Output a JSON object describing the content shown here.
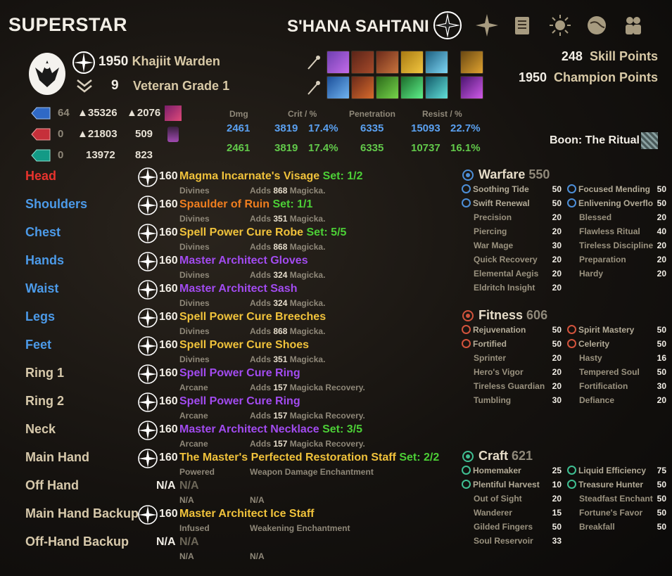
{
  "header": {
    "title": "SUPERSTAR",
    "character_name": "S'HANA SAHTANI",
    "nav_icons": [
      "champion-icon",
      "skills-icon",
      "scroll-icon",
      "sun-icon",
      "globe-icon",
      "group-icon"
    ]
  },
  "profile": {
    "cp_level": "1950",
    "race_class": "Khajiit Warden",
    "rank": "9",
    "grade": "Veteran Grade 1"
  },
  "points": {
    "skill_value": "248",
    "skill_label": "Skill Points",
    "champion_value": "1950",
    "champion_label": "Champion Points"
  },
  "resources": [
    {
      "color": "#2f69c6",
      "a": "64",
      "b": "▲35326",
      "c": "▲2076"
    },
    {
      "color": "#c6303a",
      "a": "0",
      "b": "▲21803",
      "c": "509"
    },
    {
      "color": "#139a86",
      "a": "0",
      "b": "13972",
      "c": "823"
    }
  ],
  "stats": {
    "headers": {
      "dmg": "Dmg",
      "crit": "Crit / %",
      "pen": "Penetration",
      "resist": "Resist / %"
    },
    "row1": {
      "dmg": "2461",
      "crit": "3819",
      "crit_pct": "17.4%",
      "pen": "6335",
      "resist": "15093",
      "resist_pct": "22.7%"
    },
    "row2": {
      "dmg": "2461",
      "crit": "3819",
      "crit_pct": "17.4%",
      "pen": "6335",
      "resist": "10737",
      "resist_pct": "16.1%"
    }
  },
  "boon": "Boon: The Ritual",
  "equipment": [
    {
      "slot": "Head",
      "cp": "160",
      "item": "Magma Incarnate's Visage",
      "set": "Set: 1/2",
      "trait": "Divines",
      "enchant_pre": "Adds",
      "enchant_val": "868",
      "enchant_post": "Magicka."
    },
    {
      "slot": "Shoulders",
      "cp": "160",
      "item": "Spaulder of Ruin",
      "set": "Set: 1/1",
      "trait": "Divines",
      "enchant_pre": "Adds",
      "enchant_val": "351",
      "enchant_post": "Magicka."
    },
    {
      "slot": "Chest",
      "cp": "160",
      "item": "Spell Power Cure Robe",
      "set": "Set: 5/5",
      "trait": "Divines",
      "enchant_pre": "Adds",
      "enchant_val": "868",
      "enchant_post": "Magicka."
    },
    {
      "slot": "Hands",
      "cp": "160",
      "item": "Master Architect Gloves",
      "set": "",
      "trait": "Divines",
      "enchant_pre": "Adds",
      "enchant_val": "324",
      "enchant_post": "Magicka."
    },
    {
      "slot": "Waist",
      "cp": "160",
      "item": "Master Architect Sash",
      "set": "",
      "trait": "Divines",
      "enchant_pre": "Adds",
      "enchant_val": "324",
      "enchant_post": "Magicka."
    },
    {
      "slot": "Legs",
      "cp": "160",
      "item": "Spell Power Cure Breeches",
      "set": "",
      "trait": "Divines",
      "enchant_pre": "Adds",
      "enchant_val": "868",
      "enchant_post": "Magicka."
    },
    {
      "slot": "Feet",
      "cp": "160",
      "item": "Spell Power Cure Shoes",
      "set": "",
      "trait": "Divines",
      "enchant_pre": "Adds",
      "enchant_val": "351",
      "enchant_post": "Magicka."
    },
    {
      "slot": "Ring 1",
      "cp": "160",
      "item": "Spell Power Cure Ring",
      "set": "",
      "trait": "Arcane",
      "enchant_pre": "Adds",
      "enchant_val": "157",
      "enchant_post": "Magicka Recovery."
    },
    {
      "slot": "Ring 2",
      "cp": "160",
      "item": "Spell Power Cure Ring",
      "set": "",
      "trait": "Arcane",
      "enchant_pre": "Adds",
      "enchant_val": "157",
      "enchant_post": "Magicka Recovery."
    },
    {
      "slot": "Neck",
      "cp": "160",
      "item": "Master Architect Necklace",
      "set": "Set: 3/5",
      "trait": "Arcane",
      "enchant_pre": "Adds",
      "enchant_val": "157",
      "enchant_post": "Magicka Recovery."
    },
    {
      "slot": "Main Hand",
      "cp": "160",
      "item": "The Master's Perfected Restoration Staff",
      "set": "Set: 2/2",
      "trait": "Powered",
      "enchant_pre": "Weapon Damage Enchantment",
      "enchant_val": "",
      "enchant_post": ""
    },
    {
      "slot": "Off Hand",
      "cp": "N/A",
      "item": "N/A",
      "set": "",
      "trait": "N/A",
      "enchant_pre": "N/A",
      "enchant_val": "",
      "enchant_post": ""
    },
    {
      "slot": "Main Hand Backup",
      "cp": "160",
      "item": "Master Architect Ice Staff",
      "set": "",
      "trait": "Infused",
      "enchant_pre": "Weakening Enchantment",
      "enchant_val": "",
      "enchant_post": ""
    },
    {
      "slot": "Off-Hand Backup",
      "cp": "N/A",
      "item": "N/A",
      "set": "",
      "trait": "N/A",
      "enchant_pre": "N/A",
      "enchant_val": "",
      "enchant_post": ""
    }
  ],
  "champion": {
    "warfare": {
      "name": "Warfare",
      "total": "550",
      "left": [
        {
          "name": "Soothing Tide",
          "v": "50"
        },
        {
          "name": "Swift Renewal",
          "v": "50"
        },
        {
          "name": "Precision",
          "v": "20"
        },
        {
          "name": "Piercing",
          "v": "20"
        },
        {
          "name": "War Mage",
          "v": "30"
        },
        {
          "name": "Quick Recovery",
          "v": "20"
        },
        {
          "name": "Elemental Aegis",
          "v": "20"
        },
        {
          "name": "Eldritch Insight",
          "v": "20"
        }
      ],
      "right": [
        {
          "name": "Focused Mending",
          "v": "50"
        },
        {
          "name": "Enlivening Overflo",
          "v": "50"
        },
        {
          "name": "Blessed",
          "v": "20"
        },
        {
          "name": "Flawless Ritual",
          "v": "40"
        },
        {
          "name": "Tireless Discipline",
          "v": "20"
        },
        {
          "name": "Preparation",
          "v": "20"
        },
        {
          "name": "Hardy",
          "v": "20"
        }
      ]
    },
    "fitness": {
      "name": "Fitness",
      "total": "606",
      "left": [
        {
          "name": "Rejuvenation",
          "v": "50"
        },
        {
          "name": "Fortified",
          "v": "50"
        },
        {
          "name": "Sprinter",
          "v": "20"
        },
        {
          "name": "Hero's Vigor",
          "v": "20"
        },
        {
          "name": "Tireless Guardian",
          "v": "20"
        },
        {
          "name": "Tumbling",
          "v": "30"
        }
      ],
      "right": [
        {
          "name": "Spirit Mastery",
          "v": "50"
        },
        {
          "name": "Celerity",
          "v": "50"
        },
        {
          "name": "Hasty",
          "v": "16"
        },
        {
          "name": "Tempered Soul",
          "v": "50"
        },
        {
          "name": "Fortification",
          "v": "30"
        },
        {
          "name": "Defiance",
          "v": "20"
        }
      ]
    },
    "craft": {
      "name": "Craft",
      "total": "621",
      "left": [
        {
          "name": "Homemaker",
          "v": "25"
        },
        {
          "name": "Plentiful Harvest",
          "v": "10"
        },
        {
          "name": "Out of Sight",
          "v": "20"
        },
        {
          "name": "Wanderer",
          "v": "15"
        },
        {
          "name": "Gilded Fingers",
          "v": "50"
        },
        {
          "name": "Soul Reservoir",
          "v": "33"
        }
      ],
      "right": [
        {
          "name": "Liquid Efficiency",
          "v": "75"
        },
        {
          "name": "Treasure Hunter",
          "v": "50"
        },
        {
          "name": "Steadfast Enchant",
          "v": "50"
        },
        {
          "name": "Fortune's Favor",
          "v": "50"
        },
        {
          "name": "Breakfall",
          "v": "50"
        }
      ]
    }
  }
}
